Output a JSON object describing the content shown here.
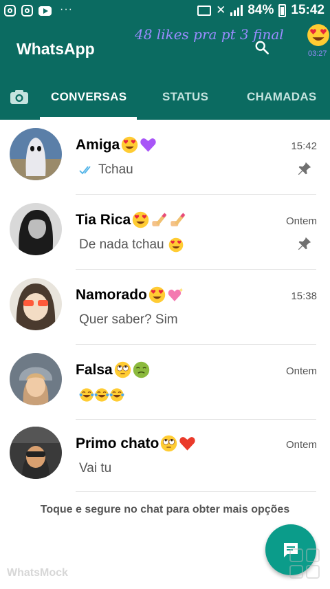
{
  "status_bar": {
    "battery": "84%",
    "time": "15:42",
    "notification_icons": [
      "instagram-icon",
      "instagram-icon",
      "youtube-icon"
    ]
  },
  "app_bar": {
    "title": "WhatsApp",
    "overlay_caption": "48 likes pra pt 3 final",
    "overlay_time": "03:27"
  },
  "tabs": [
    {
      "label": "CONVERSAS",
      "active": true
    },
    {
      "label": "STATUS",
      "active": false
    },
    {
      "label": "CHAMADAS",
      "active": false
    }
  ],
  "chats": [
    {
      "name": "Amiga",
      "name_emojis": [
        "heart-eyes",
        "purple-heart"
      ],
      "message": "Tchau",
      "message_emojis": [],
      "read_ticks": true,
      "time": "15:42",
      "pinned": true
    },
    {
      "name": "Tia Rica",
      "name_emojis": [
        "heart-eyes",
        "nail-polish",
        "nail-polish"
      ],
      "message": "De nada tchau",
      "message_emojis": [
        "heart-eyes"
      ],
      "read_ticks": false,
      "time": "Ontem",
      "pinned": true
    },
    {
      "name": "Namorado",
      "name_emojis": [
        "heart-eyes",
        "sparkling-heart"
      ],
      "message": "Quer saber? Sim",
      "message_emojis": [],
      "read_ticks": false,
      "time": "15:38",
      "pinned": false
    },
    {
      "name": "Falsa",
      "name_emojis": [
        "rolling-eyes",
        "nauseated"
      ],
      "message": "",
      "message_emojis": [
        "tears-of-joy",
        "tears-of-joy",
        "tears-of-joy"
      ],
      "read_ticks": false,
      "time": "Ontem",
      "pinned": false
    },
    {
      "name": "Primo chato",
      "name_emojis": [
        "rolling-eyes",
        "red-heart"
      ],
      "message": "Vai tu",
      "message_emojis": [],
      "read_ticks": false,
      "time": "Ontem",
      "pinned": false
    }
  ],
  "hint": "Toque e segure no chat para obter mais opções",
  "watermark": "WhatsMock",
  "colors": {
    "primary": "#0b6b61",
    "fab": "#0b9c8a",
    "overlay_text": "#9b8cff",
    "read_ticks": "#4fb3e8"
  }
}
